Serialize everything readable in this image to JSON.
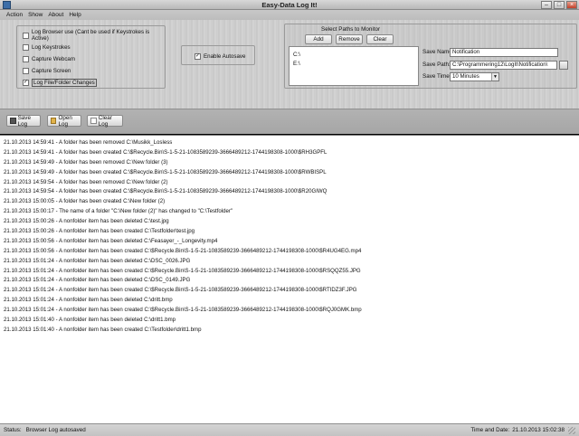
{
  "window": {
    "title": "Easy-Data Log It!"
  },
  "menu": {
    "items": [
      "Action",
      "Show",
      "About",
      "Help"
    ]
  },
  "options": [
    {
      "label": "Log Browser use (Cant be used if Keystrokes is Active)",
      "checked": false
    },
    {
      "label": "Log Keystrokes",
      "checked": false
    },
    {
      "label": "Capture Webcam",
      "checked": false
    },
    {
      "label": "Capture Screen",
      "checked": false
    },
    {
      "label": "Log File/Folder Changes",
      "checked": true
    }
  ],
  "autosave": {
    "label": "Enable Autosave",
    "checked": true
  },
  "paths": {
    "title": "Select Paths to Monitor",
    "add_label": "Add",
    "remove_label": "Remove",
    "clear_label": "Clear",
    "items": [
      "C:\\",
      "E:\\"
    ]
  },
  "settings": {
    "save_name_label": "Save Name:",
    "save_name_value": "Notification",
    "save_path_label": "Save Path:",
    "save_path_value": "C:\\Programmering12\\LogIt\\Notification\\",
    "save_times_label": "Save Times:",
    "save_times_value": "10 Minutes"
  },
  "toolbar": {
    "save_label": "Save Log",
    "open_label": "Open Log",
    "clear_label": "Clear Log"
  },
  "log": [
    "21.10.2013 14:59:41 - A folder has been removed C:\\Musikk_Losless",
    "21.10.2013 14:59:41 - A folder has been created C:\\$Recycle.Bin\\S-1-5-21-1083589239-3666489212-1744198308-1000\\$RH3GPFL",
    "21.10.2013 14:59:49 - A folder has been removed C:\\New folder (3)",
    "21.10.2013 14:59:49 - A folder has been created C:\\$Recycle.Bin\\S-1-5-21-1083589239-3666489212-1744198308-1000\\$RWBISPL",
    "21.10.2013 14:59:54 - A folder has been removed C:\\New folder (2)",
    "21.10.2013 14:59:54 - A folder has been created C:\\$Recycle.Bin\\S-1-5-21-1083589239-3666489212-1744198308-1000\\$R20GIWQ",
    "21.10.2013 15:00:05 - A folder has been created C:\\New folder (2)",
    "21.10.2013 15:00:17 - The name of a folder \"C:\\New folder (2)\" has changed to \"C:\\Testfolder\"",
    "21.10.2013 15:00:26 - A nonfolder item has been deleted C:\\test.jpg",
    "21.10.2013 15:00:26 - A nonfolder item has been created C:\\Testfolder\\test.jpg",
    "21.10.2013 15:00:56 - A nonfolder item has been deleted C:\\Feasayer_-_Longevity.mp4",
    "21.10.2013 15:00:56 - A nonfolder item has been created C:\\$Recycle.Bin\\S-1-5-21-1083589239-3666489212-1744198308-1000\\$R4UG4EG.mp4",
    "21.10.2013 15:01:24 - A nonfolder item has been deleted C:\\DSC_0026.JPG",
    "21.10.2013 15:01:24 - A nonfolder item has been created C:\\$Recycle.Bin\\S-1-5-21-1083589239-3666489212-1744198308-1000\\$RSQQZ55.JPG",
    "21.10.2013 15:01:24 - A nonfolder item has been deleted C:\\DSC_0149.JPG",
    "21.10.2013 15:01:24 - A nonfolder item has been created C:\\$Recycle.Bin\\S-1-5-21-1083589239-3666489212-1744198308-1000\\$RTIDZ3F.JPG",
    "21.10.2013 15:01:24 - A nonfolder item has been deleted C:\\dritt.bmp",
    "21.10.2013 15:01:24 - A nonfolder item has been created C:\\$Recycle.Bin\\S-1-5-21-1083589239-3666489212-1744198308-1000\\$RQJ0GMK.bmp",
    "21.10.2013 15:01:40 - A nonfolder item has been deleted C:\\dritt1.bmp",
    "21.10.2013 15:01:40 - A nonfolder item has been created C:\\Testfolder\\dritt1.bmp"
  ],
  "status": {
    "status_label": "Status:",
    "status_value": "Browser Log autosaved",
    "time_label": "Time and Date:",
    "time_value": "21.10.2013 15:02:38"
  }
}
